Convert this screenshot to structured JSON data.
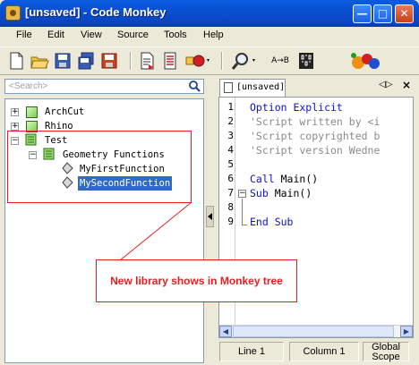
{
  "window": {
    "title": "[unsaved] - Code Monkey"
  },
  "menu": [
    "File",
    "Edit",
    "View",
    "Source",
    "Tools",
    "Help"
  ],
  "toolbar": {
    "text_button": "A→B"
  },
  "search": {
    "placeholder": "<Search>"
  },
  "tree": {
    "items": [
      {
        "label": "ArchCut"
      },
      {
        "label": "Rhino"
      },
      {
        "label": "Test"
      },
      {
        "label": "Geometry Functions"
      },
      {
        "label": "MyFirstFunction"
      },
      {
        "label": "MySecondFunction",
        "selected": true
      }
    ]
  },
  "editor": {
    "tab_label": "[unsaved]",
    "tab_nav": "◁▷",
    "tab_close": "×",
    "line_numbers": [
      "1",
      "2",
      "3",
      "4",
      "5",
      "6",
      "7",
      "8",
      "9"
    ],
    "lines": [
      {
        "text": "Option Explicit",
        "kind": "keyword"
      },
      {
        "text": "'Script written by <i",
        "kind": "comment"
      },
      {
        "text": "'Script copyrighted b",
        "kind": "comment"
      },
      {
        "text": "'Script version Wedne",
        "kind": "comment"
      },
      {
        "text": "",
        "kind": "plain"
      },
      {
        "text": "Call Main()",
        "kind": "mixed"
      },
      {
        "text": "Sub Main()",
        "kind": "mixed"
      },
      {
        "text": "",
        "kind": "plain"
      },
      {
        "text": "End Sub",
        "kind": "keyword"
      }
    ],
    "line6": {
      "kw": "Call",
      "rest": " Main()"
    },
    "line7": {
      "kw": "Sub",
      "rest": " Main()"
    }
  },
  "status": {
    "line": "Line 1",
    "column": "Column 1",
    "scope_1": "Global",
    "scope_2": "Scope"
  },
  "annotation": {
    "text": "New library shows in Monkey tree"
  },
  "colors": {
    "annotation": "#e02020",
    "keyword": "#1010d0",
    "comment": "#8a8a8a",
    "selection": "#316ac5"
  }
}
